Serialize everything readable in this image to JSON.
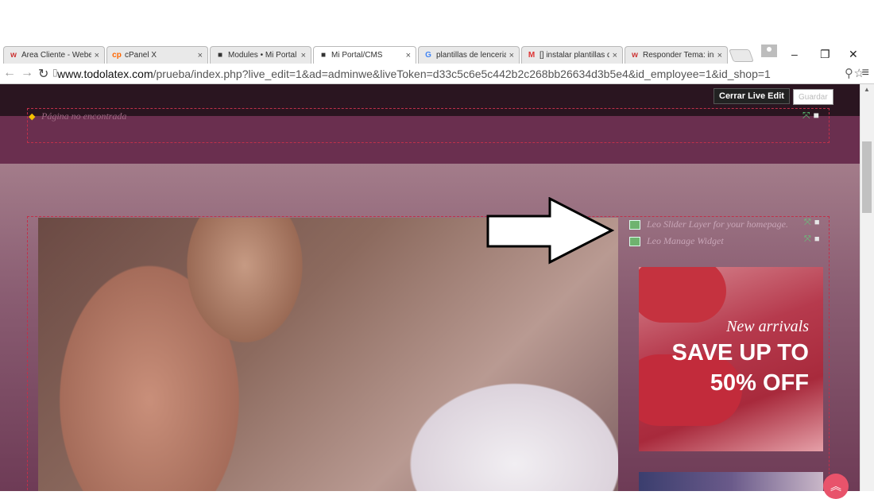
{
  "browser": {
    "tabs": [
      {
        "label": "Área Cliente - Webe",
        "favicon": "w"
      },
      {
        "label": "cPanel X",
        "favicon": "cp"
      },
      {
        "label": "Modules • Mi Portal",
        "favicon": "■"
      },
      {
        "label": "Mi Portal/CMS",
        "favicon": "■",
        "active": true
      },
      {
        "label": "plantillas de lenceria",
        "favicon": "G"
      },
      {
        "label": "[] instalar plantillas d",
        "favicon": "M"
      },
      {
        "label": "Responder Tema: ins",
        "favicon": "w"
      }
    ],
    "url_host": "www.todolatex.com",
    "url_path": "/prueba/index.php?live_edit=1&ad=adminwe&liveToken=d33c5c6e5c442b2c268bb26634d3b5e4&id_employee=1&id_shop=1"
  },
  "toolbar": {
    "close_live_edit": "Cerrar Live Edit",
    "save": "Guardar"
  },
  "page": {
    "not_found": "Página no encontrada",
    "widgets": [
      {
        "label": "Leo Slider Layer for your homepage."
      },
      {
        "label": "Leo Manage Widget"
      }
    ],
    "promo": {
      "line1": "New arrivals",
      "line2": "SAVE UP TO",
      "line3": "50% OFF"
    }
  },
  "colors": {
    "accent": "#e8536b",
    "topbar": "#2a1520",
    "band": "#6a2f4f"
  }
}
